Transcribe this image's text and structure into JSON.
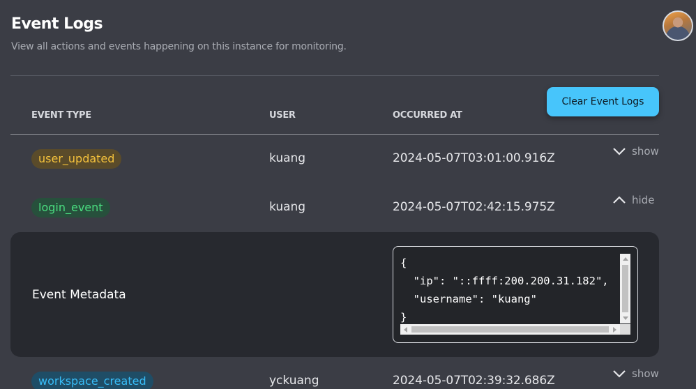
{
  "header": {
    "title": "Event Logs",
    "subtitle": "View all actions and events happening on this instance for monitoring."
  },
  "actions": {
    "clear_label": "Clear Event Logs"
  },
  "table": {
    "headers": {
      "event_type": "EVENT TYPE",
      "user": "USER",
      "occurred_at": "OCCURRED AT"
    },
    "rows": [
      {
        "event": "user_updated",
        "badge_color": "#f5c23c",
        "user": "kuang",
        "occurred_at": "2024-05-07T03:01:00.916Z",
        "toggle": "show",
        "toggle_icon": "chevron-down-icon"
      },
      {
        "event": "login_event",
        "badge_color": "#4ade80",
        "user": "kuang",
        "occurred_at": "2024-05-07T02:42:15.975Z",
        "toggle": "hide",
        "toggle_icon": "chevron-up-icon"
      },
      {
        "event": "workspace_created",
        "badge_color": "#38bdf8",
        "user": "yckuang",
        "occurred_at": "2024-05-07T02:39:32.686Z",
        "toggle": "show",
        "toggle_icon": "chevron-down-icon"
      }
    ]
  },
  "metadata": {
    "label": "Event Metadata",
    "json_text": "{\n  \"ip\": \"::ffff:200.200.31.182\",\n  \"username\": \"kuang\"\n}"
  },
  "colors": {
    "background": "#3b3d45",
    "panel": "#27292f",
    "accent": "#47c5fb"
  }
}
